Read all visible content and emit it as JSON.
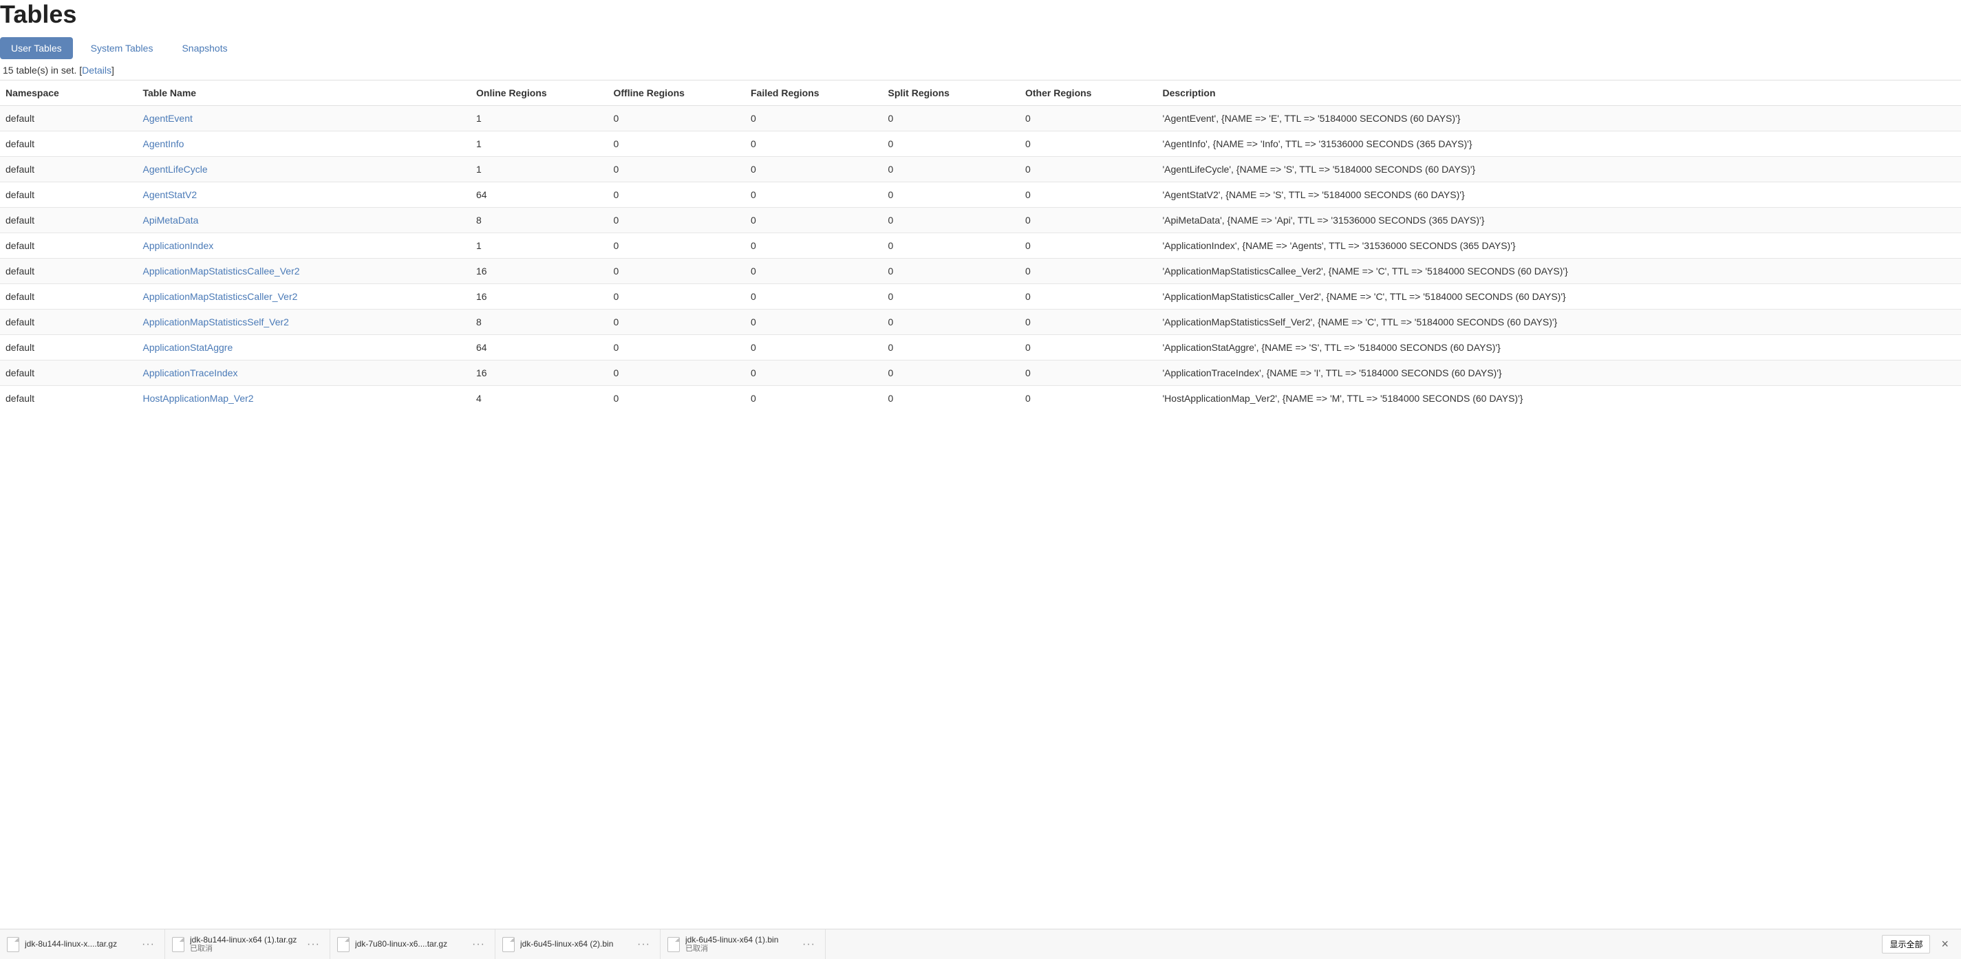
{
  "header": {
    "title": "Tables"
  },
  "tabs": {
    "items": [
      {
        "label": "User Tables",
        "active": true
      },
      {
        "label": "System Tables",
        "active": false
      },
      {
        "label": "Snapshots",
        "active": false
      }
    ]
  },
  "summary": {
    "count_text": "15 table(s) in set. ",
    "details_label": "Details"
  },
  "columns": {
    "namespace": "Namespace",
    "table_name": "Table Name",
    "online": "Online Regions",
    "offline": "Offline Regions",
    "failed": "Failed Regions",
    "split": "Split Regions",
    "other": "Other Regions",
    "description": "Description"
  },
  "rows": [
    {
      "ns": "default",
      "name": "AgentEvent",
      "online": "1",
      "offline": "0",
      "failed": "0",
      "split": "0",
      "other": "0",
      "desc": "'AgentEvent', {NAME => 'E', TTL => '5184000 SECONDS (60 DAYS)'}"
    },
    {
      "ns": "default",
      "name": "AgentInfo",
      "online": "1",
      "offline": "0",
      "failed": "0",
      "split": "0",
      "other": "0",
      "desc": "'AgentInfo', {NAME => 'Info', TTL => '31536000 SECONDS (365 DAYS)'}"
    },
    {
      "ns": "default",
      "name": "AgentLifeCycle",
      "online": "1",
      "offline": "0",
      "failed": "0",
      "split": "0",
      "other": "0",
      "desc": "'AgentLifeCycle', {NAME => 'S', TTL => '5184000 SECONDS (60 DAYS)'}"
    },
    {
      "ns": "default",
      "name": "AgentStatV2",
      "online": "64",
      "offline": "0",
      "failed": "0",
      "split": "0",
      "other": "0",
      "desc": "'AgentStatV2', {NAME => 'S', TTL => '5184000 SECONDS (60 DAYS)'}"
    },
    {
      "ns": "default",
      "name": "ApiMetaData",
      "online": "8",
      "offline": "0",
      "failed": "0",
      "split": "0",
      "other": "0",
      "desc": "'ApiMetaData', {NAME => 'Api', TTL => '31536000 SECONDS (365 DAYS)'}"
    },
    {
      "ns": "default",
      "name": "ApplicationIndex",
      "online": "1",
      "offline": "0",
      "failed": "0",
      "split": "0",
      "other": "0",
      "desc": "'ApplicationIndex', {NAME => 'Agents', TTL => '31536000 SECONDS (365 DAYS)'}"
    },
    {
      "ns": "default",
      "name": "ApplicationMapStatisticsCallee_Ver2",
      "online": "16",
      "offline": "0",
      "failed": "0",
      "split": "0",
      "other": "0",
      "desc": "'ApplicationMapStatisticsCallee_Ver2', {NAME => 'C', TTL => '5184000 SECONDS (60 DAYS)'}"
    },
    {
      "ns": "default",
      "name": "ApplicationMapStatisticsCaller_Ver2",
      "online": "16",
      "offline": "0",
      "failed": "0",
      "split": "0",
      "other": "0",
      "desc": "'ApplicationMapStatisticsCaller_Ver2', {NAME => 'C', TTL => '5184000 SECONDS (60 DAYS)'}"
    },
    {
      "ns": "default",
      "name": "ApplicationMapStatisticsSelf_Ver2",
      "online": "8",
      "offline": "0",
      "failed": "0",
      "split": "0",
      "other": "0",
      "desc": "'ApplicationMapStatisticsSelf_Ver2', {NAME => 'C', TTL => '5184000 SECONDS (60 DAYS)'}"
    },
    {
      "ns": "default",
      "name": "ApplicationStatAggre",
      "online": "64",
      "offline": "0",
      "failed": "0",
      "split": "0",
      "other": "0",
      "desc": "'ApplicationStatAggre', {NAME => 'S', TTL => '5184000 SECONDS (60 DAYS)'}"
    },
    {
      "ns": "default",
      "name": "ApplicationTraceIndex",
      "online": "16",
      "offline": "0",
      "failed": "0",
      "split": "0",
      "other": "0",
      "desc": "'ApplicationTraceIndex', {NAME => 'I', TTL => '5184000 SECONDS (60 DAYS)'}"
    },
    {
      "ns": "default",
      "name": "HostApplicationMap_Ver2",
      "online": "4",
      "offline": "0",
      "failed": "0",
      "split": "0",
      "other": "0",
      "desc": "'HostApplicationMap_Ver2', {NAME => 'M', TTL => '5184000 SECONDS (60 DAYS)'}"
    }
  ],
  "downloads": {
    "items": [
      {
        "name": "jdk-8u144-linux-x....tar.gz",
        "status": ""
      },
      {
        "name": "jdk-8u144-linux-x64 (1).tar.gz",
        "status": "已取消"
      },
      {
        "name": "jdk-7u80-linux-x6....tar.gz",
        "status": ""
      },
      {
        "name": "jdk-6u45-linux-x64 (2).bin",
        "status": ""
      },
      {
        "name": "jdk-6u45-linux-x64 (1).bin",
        "status": "已取消"
      }
    ],
    "show_all": "显示全部",
    "more_glyph": "···",
    "close_glyph": "×"
  }
}
